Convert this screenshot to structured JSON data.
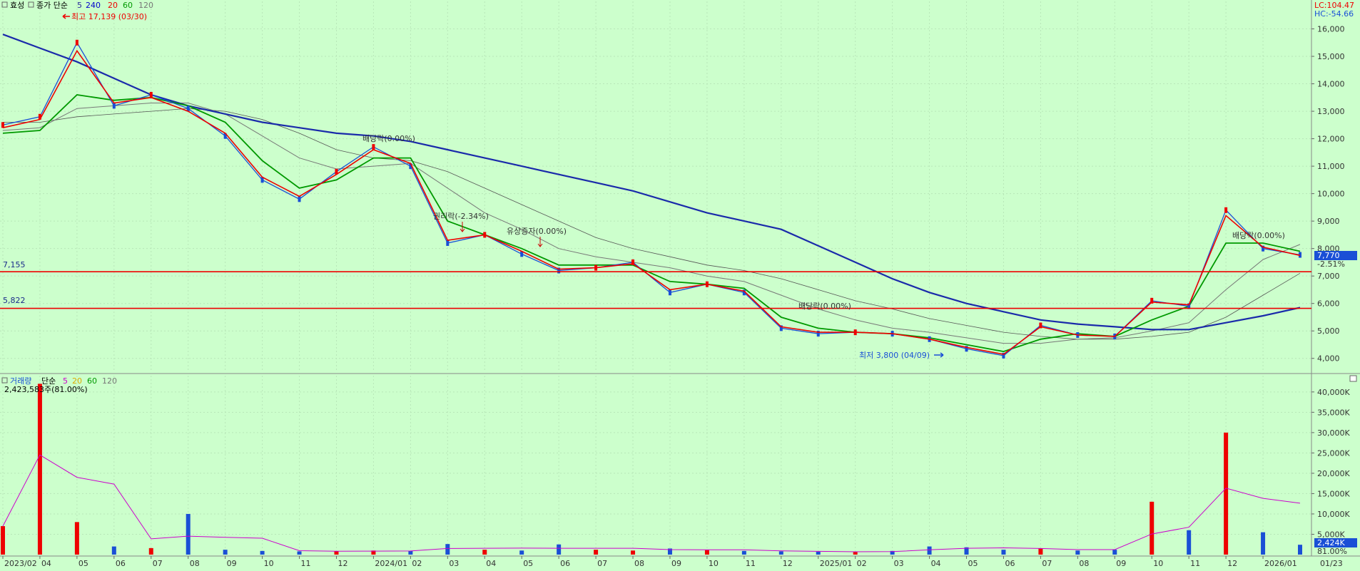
{
  "top_panel": {
    "stock_name": "효성",
    "indicator": "종가 단순",
    "ma_periods": [
      "5",
      "240",
      "20",
      "60",
      "120"
    ],
    "ma_colors": [
      "#2a2a9a",
      "#0000cc",
      "#ee0000",
      "#009900",
      "#777777"
    ],
    "lc": "LC:104.47",
    "hc": "HC:-54.66"
  },
  "bottom_panel": {
    "title": "거래량",
    "indicator": "단순",
    "ma_periods": [
      "5",
      "20",
      "60",
      "120"
    ],
    "ma_colors": [
      "#cc00cc",
      "#ddaa00",
      "#009900",
      "#777777"
    ],
    "volume_readout": "2,423,583주(81.00%)"
  },
  "annotations": {
    "high": "최고 17,139 (03/30)",
    "low": "최저 3,800 (04/09)",
    "exdiv1": "배당락(0.00%)",
    "exright": "권리락(-2.34%)",
    "rights_issue": "유상증자(0.00%)",
    "exdiv2": "배당락(0.00%)",
    "exdiv3": "배당락(0.00%)"
  },
  "levels": {
    "upper_label": "7,155",
    "lower_label": "5,822",
    "line_color": "#ee0000"
  },
  "price_axis": {
    "ticks": [
      "16,000",
      "15,000",
      "14,000",
      "13,000",
      "12,000",
      "11,000",
      "10,000",
      "9,000",
      "8,000",
      "7,000",
      "6,000",
      "5,000",
      "4,000"
    ],
    "current_price": "7,770",
    "current_change": "-2.51%"
  },
  "volume_axis": {
    "ticks": [
      "40,000K",
      "35,000K",
      "30,000K",
      "25,000K",
      "20,000K",
      "15,000K",
      "10,000K",
      "5,000K"
    ],
    "current_volume": "2,424K",
    "current_ratio": "81.00%"
  },
  "time_axis": {
    "labels": [
      "2023/02",
      "04",
      "05",
      "06",
      "07",
      "08",
      "09",
      "10",
      "11",
      "12",
      "2024/01",
      "02",
      "03",
      "04",
      "05",
      "06",
      "07",
      "08",
      "09",
      "10",
      "11",
      "12",
      "2025/01",
      "02",
      "03",
      "04",
      "05",
      "06",
      "07",
      "08",
      "09",
      "10",
      "11",
      "12",
      "2026/01",
      "01/23"
    ]
  },
  "colors": {
    "background": "#ccffcc",
    "candle_up": "#ee0000",
    "candle_down": "#1a4fd6",
    "ma5": "#ee0000",
    "ma20": "#009900",
    "ma60": "#777777",
    "ma240": "#1a2aaa"
  },
  "chart_data": [
    {
      "type": "line",
      "panel": "price",
      "x": [
        "2023/02",
        "2023/03",
        "2023/04",
        "2023/05",
        "2023/06",
        "2023/07",
        "2023/08",
        "2023/09",
        "2023/10",
        "2023/11",
        "2023/12",
        "2024/01",
        "2024/02",
        "2024/03",
        "2024/04",
        "2024/05",
        "2024/06",
        "2024/07",
        "2024/08",
        "2024/09",
        "2024/10",
        "2024/11",
        "2024/12",
        "2025/01",
        "2025/02",
        "2025/03",
        "2025/04",
        "2025/05",
        "2025/06",
        "2025/07",
        "2025/08",
        "2025/09",
        "2025/10",
        "2025/11",
        "2025/12",
        "2026/01"
      ],
      "series": [
        {
          "name": "종가",
          "values": [
            12500,
            12800,
            15500,
            13200,
            13600,
            13100,
            12100,
            10500,
            9800,
            10800,
            11700,
            11000,
            8200,
            8500,
            7800,
            7200,
            7300,
            7500,
            6400,
            6700,
            6400,
            5100,
            4900,
            4950,
            4900,
            4700,
            4350,
            4100,
            5200,
            4850,
            4800,
            6100,
            5900,
            9400,
            8000,
            7770
          ]
        },
        {
          "name": "5",
          "values": [
            12400,
            12700,
            15200,
            13300,
            13500,
            13000,
            12200,
            10600,
            9900,
            10700,
            11600,
            11100,
            8300,
            8500,
            7900,
            7250,
            7300,
            7450,
            6500,
            6700,
            6450,
            5150,
            4950,
            4950,
            4900,
            4700,
            4400,
            4150,
            5150,
            4850,
            4800,
            6050,
            5950,
            9200,
            8050,
            7750
          ]
        },
        {
          "name": "20",
          "values": [
            12200,
            12300,
            13600,
            13400,
            13500,
            13200,
            12600,
            11200,
            10200,
            10500,
            11300,
            11300,
            9000,
            8500,
            8000,
            7400,
            7400,
            7400,
            6800,
            6700,
            6550,
            5500,
            5100,
            4950,
            4900,
            4750,
            4500,
            4250,
            4700,
            4900,
            4800,
            5400,
            5900,
            8200,
            8200,
            7900
          ]
        },
        {
          "name": "60",
          "values": [
            12300,
            12400,
            13100,
            13200,
            13300,
            13300,
            12900,
            12100,
            11300,
            10900,
            11000,
            11100,
            10200,
            9300,
            8700,
            8000,
            7700,
            7500,
            7300,
            7000,
            6800,
            6300,
            5800,
            5400,
            5100,
            4950,
            4750,
            4550,
            4550,
            4700,
            4750,
            5000,
            5300,
            6500,
            7600,
            8150
          ]
        },
        {
          "name": "120",
          "values": [
            12600,
            12600,
            12800,
            12900,
            13000,
            13100,
            13000,
            12700,
            12200,
            11600,
            11300,
            11200,
            10800,
            10200,
            9600,
            9000,
            8400,
            8000,
            7700,
            7400,
            7200,
            6900,
            6500,
            6100,
            5800,
            5450,
            5200,
            4950,
            4800,
            4700,
            4700,
            4800,
            4950,
            5500,
            6300,
            7100
          ]
        },
        {
          "name": "240",
          "values": [
            15800,
            15300,
            14800,
            14200,
            13600,
            13200,
            12900,
            12600,
            12400,
            12200,
            12100,
            11900,
            11600,
            11300,
            11000,
            10700,
            10400,
            10100,
            9700,
            9300,
            9000,
            8700,
            8100,
            7500,
            6900,
            6400,
            6000,
            5700,
            5400,
            5250,
            5150,
            5050,
            5050,
            5300,
            5550,
            5850
          ]
        }
      ],
      "ylim": [
        3500,
        17000
      ],
      "high": {
        "value": 17139,
        "date": "03/30"
      },
      "low": {
        "value": 3800,
        "date": "04/09"
      },
      "hlines": [
        7155,
        5822
      ],
      "events": [
        {
          "x": "2023/12",
          "label": "배당락(0.00%)"
        },
        {
          "x": "2024/02",
          "label": "권리락(-2.34%)"
        },
        {
          "x": "2024/04",
          "label": "유상증자(0.00%)"
        },
        {
          "x": "2024/12",
          "label": "배당락(0.00%)"
        },
        {
          "x": "2025/12",
          "label": "배당락(0.00%)"
        }
      ]
    },
    {
      "type": "bar",
      "panel": "volume",
      "categories": [
        "2023/02",
        "2023/03",
        "2023/04",
        "2023/05",
        "2023/06",
        "2023/07",
        "2023/08",
        "2023/09",
        "2023/10",
        "2023/11",
        "2023/12",
        "2024/01",
        "2024/02",
        "2024/03",
        "2024/04",
        "2024/05",
        "2024/06",
        "2024/07",
        "2024/08",
        "2024/09",
        "2024/10",
        "2024/11",
        "2024/12",
        "2025/01",
        "2025/02",
        "2025/03",
        "2025/04",
        "2025/05",
        "2025/06",
        "2025/07",
        "2025/08",
        "2025/09",
        "2025/10",
        "2025/11",
        "2025/12",
        "2026/01"
      ],
      "values": [
        7000,
        42000,
        8000,
        2000,
        1600,
        10000,
        1200,
        900,
        800,
        800,
        1000,
        900,
        2600,
        1200,
        1000,
        2500,
        1200,
        1000,
        1500,
        1100,
        900,
        800,
        700,
        600,
        900,
        2000,
        1800,
        1200,
        1500,
        1000,
        1200,
        13000,
        6000,
        30000,
        5500,
        2424
      ],
      "ylim": [
        0,
        44000
      ],
      "unit": "K"
    }
  ]
}
